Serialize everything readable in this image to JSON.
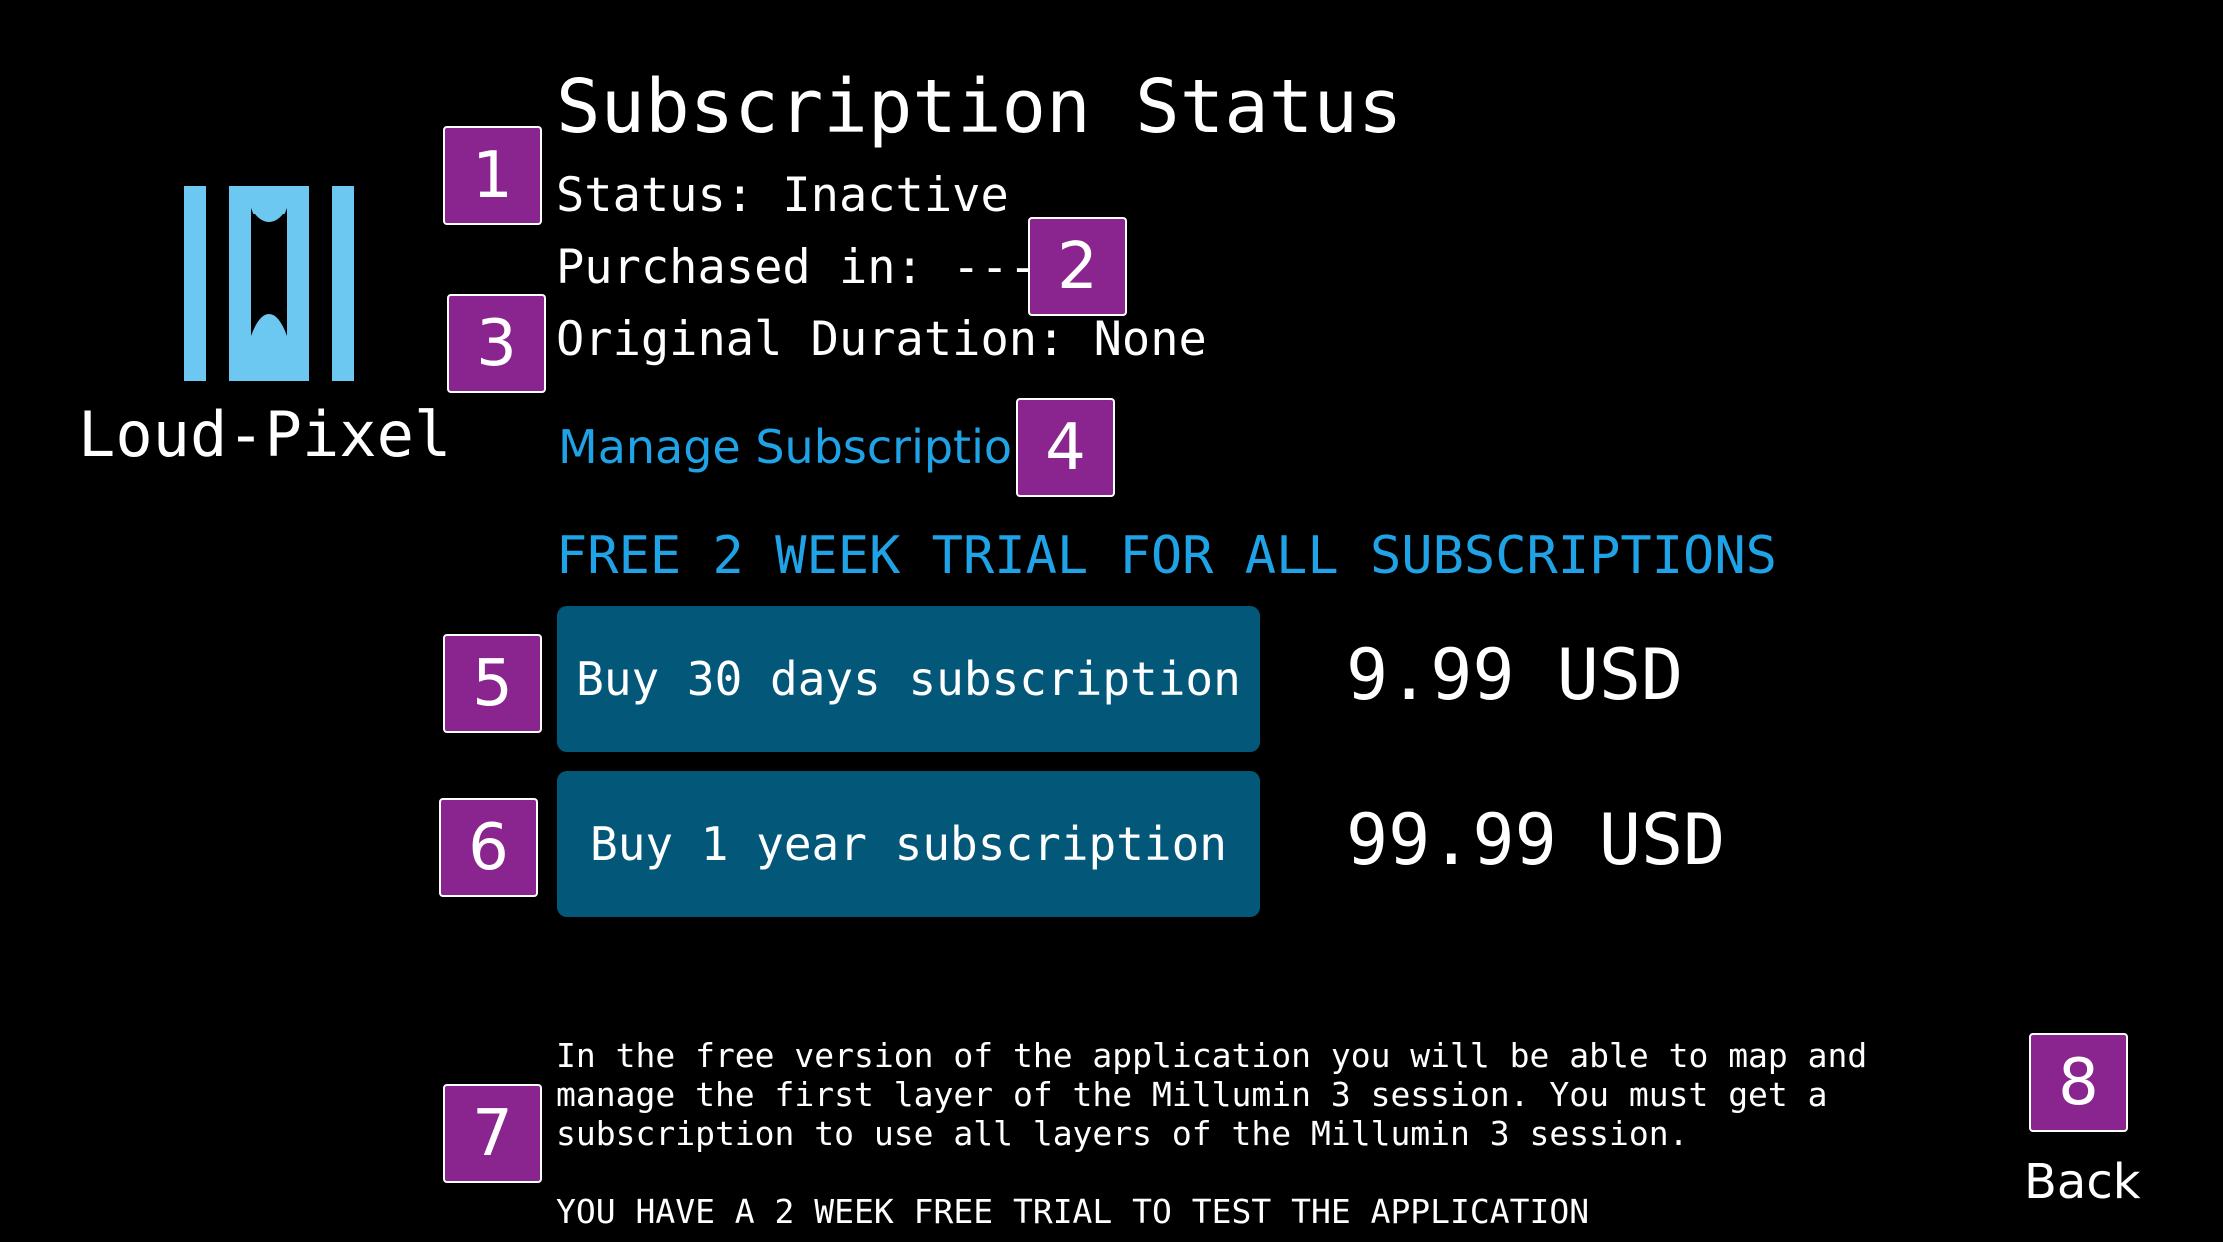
{
  "logo": {
    "name": "Loud-Pixel",
    "icon": "loud-pixel-logo-icon",
    "color": "#6cc8f0"
  },
  "title": "Subscription Status",
  "status": {
    "status_line": "Status: Inactive",
    "purchased_line": "Purchased in: ---",
    "duration_line": "Original Duration: None"
  },
  "manage_link": "Manage Subscription",
  "trial_banner": "FREE 2 WEEK TRIAL FOR ALL SUBSCRIPTIONS",
  "plans": [
    {
      "label": "Buy 30 days subscription",
      "price": "9.99 USD"
    },
    {
      "label": "Buy 1 year subscription",
      "price": "99.99 USD"
    }
  ],
  "info_text": "In the free version of the application you will be able to map and\nmanage the first layer of the Millumin 3 session. You must get a\nsubscription to use all layers of the Millumin 3 session.",
  "trial_note": "YOU HAVE A 2 WEEK FREE TRIAL TO TEST THE APPLICATION",
  "back_label": "Back",
  "badges": [
    "1",
    "2",
    "3",
    "4",
    "5",
    "6",
    "7",
    "8"
  ],
  "colors": {
    "background": "#000000",
    "accent": "#1fa3e6",
    "button": "#03587a",
    "badge": "#8a2590"
  }
}
